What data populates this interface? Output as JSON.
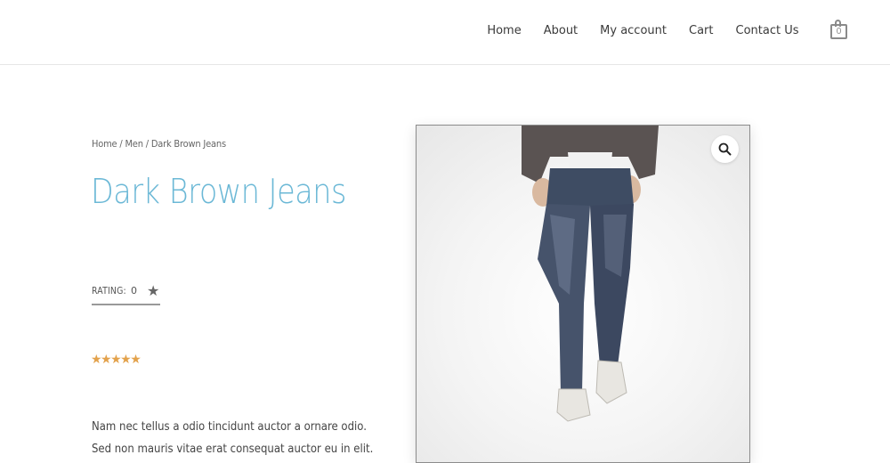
{
  "nav": {
    "items": [
      {
        "label": "Home"
      },
      {
        "label": "About"
      },
      {
        "label": "My account"
      },
      {
        "label": "Cart"
      },
      {
        "label": "Contact Us"
      }
    ],
    "cart_count": "0"
  },
  "breadcrumb": {
    "home": "Home",
    "sep1": " / ",
    "category": "Men",
    "sep2": " / ",
    "current": "Dark Brown Jeans"
  },
  "product": {
    "title": "Dark Brown Jeans",
    "rating_label": "RATING:",
    "rating_value": "0",
    "stars": "★★★★★",
    "description": [
      "Nam nec tellus a odio tincidunt auctor a ornare odio.",
      "Sed non mauris vitae erat consequat auctor eu in elit."
    ]
  },
  "icons": {
    "cart": "cart-icon",
    "zoom": "magnifier-icon",
    "rating_star": "star-icon"
  },
  "colors": {
    "title": "#6bb8d6",
    "stars": "#e3a24c"
  }
}
